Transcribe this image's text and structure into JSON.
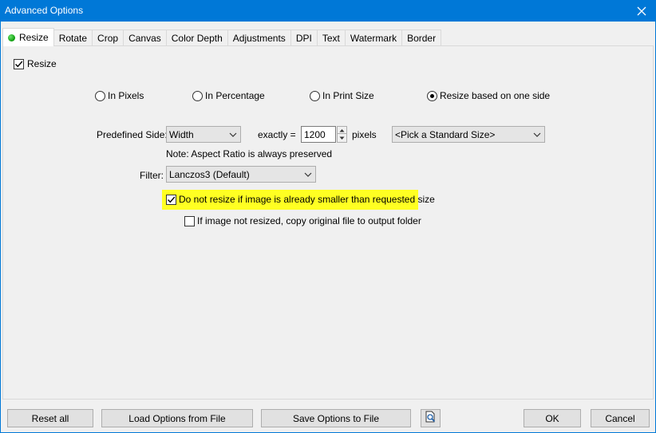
{
  "window": {
    "title": "Advanced Options"
  },
  "tabs": [
    {
      "label": "Resize",
      "active": true
    },
    {
      "label": "Rotate"
    },
    {
      "label": "Crop"
    },
    {
      "label": "Canvas"
    },
    {
      "label": "Color Depth"
    },
    {
      "label": "Adjustments"
    },
    {
      "label": "DPI"
    },
    {
      "label": "Text"
    },
    {
      "label": "Watermark"
    },
    {
      "label": "Border"
    }
  ],
  "resize": {
    "enable_label": "Resize",
    "enable_checked": true,
    "modes": [
      {
        "label": "In Pixels",
        "selected": false
      },
      {
        "label": "In Percentage",
        "selected": false
      },
      {
        "label": "In Print Size",
        "selected": false
      },
      {
        "label": "Resize based on one side",
        "selected": true
      }
    ],
    "predefined_side_label": "Predefined Side:",
    "predefined_side_value": "Width",
    "exactly_label": "exactly =",
    "size_value": "1200",
    "pixels_label": "pixels",
    "standard_size_value": "<Pick a Standard Size>",
    "aspect_note": "Note: Aspect Ratio is always preserved",
    "filter_label": "Filter:",
    "filter_value": "Lanczos3 (Default)",
    "no_upscale_label": "Do not resize if image is already smaller than requested size",
    "no_upscale_checked": true,
    "copy_original_label": "If image not resized, copy original file to output folder",
    "copy_original_checked": false
  },
  "footer": {
    "reset_all": "Reset all",
    "load_options": "Load Options from File",
    "save_options": "Save Options to File",
    "preview_icon": "magnifier-page-icon",
    "ok": "OK",
    "cancel": "Cancel"
  },
  "colors": {
    "titlebar": "#0078d7",
    "highlight": "#ffff22",
    "active_dot": "#0a9b0a"
  }
}
